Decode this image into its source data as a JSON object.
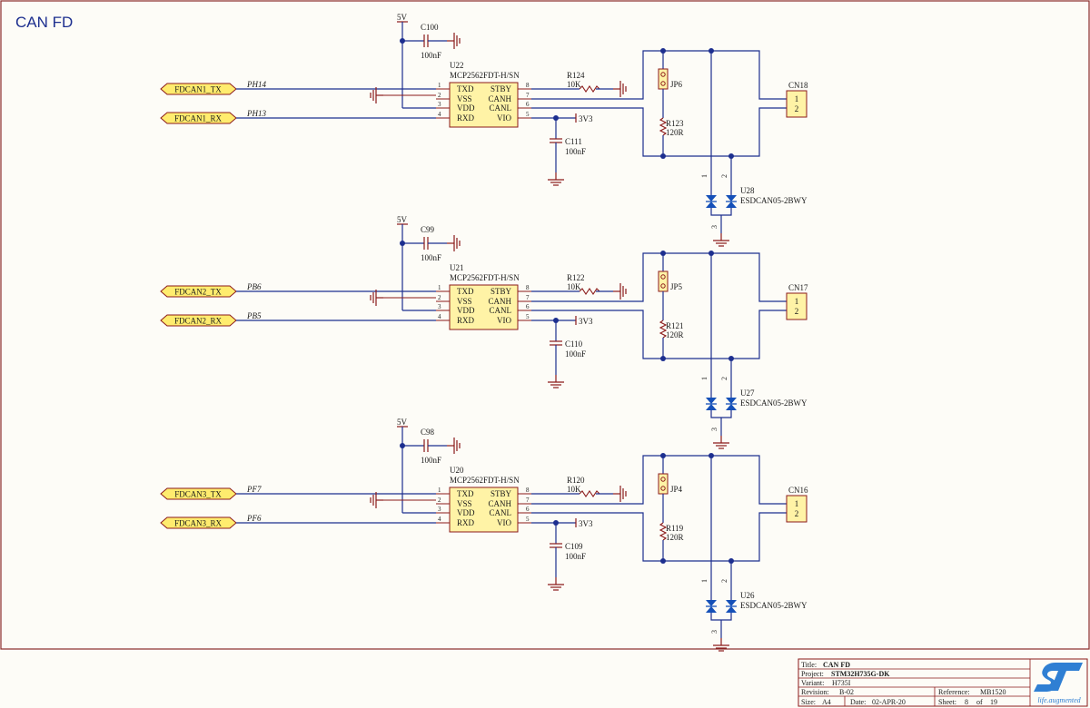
{
  "title": "CAN FD",
  "supply": {
    "v5": "5V",
    "v3": "3V3"
  },
  "pins": {
    "left": [
      {
        "num": "1",
        "name": "TXD"
      },
      {
        "num": "2",
        "name": "VSS"
      },
      {
        "num": "3",
        "name": "VDD"
      },
      {
        "num": "4",
        "name": "RXD"
      }
    ],
    "right": [
      {
        "num": "8",
        "name": "STBY"
      },
      {
        "num": "7",
        "name": "CANH"
      },
      {
        "num": "6",
        "name": "CANL"
      },
      {
        "num": "5",
        "name": "VIO"
      }
    ]
  },
  "channels": [
    {
      "tx_port": "FDCAN1_TX",
      "rx_port": "FDCAN1_RX",
      "tx_net": "PH14",
      "rx_net": "PH13",
      "cap_top": "C100",
      "cap_top_val": "100nF",
      "cap_bot": "C111",
      "cap_bot_val": "100nF",
      "ic_ref": "U22",
      "ic_part": "MCP2562FDT-H/SN",
      "res_pull": "R124",
      "res_pull_val": "10K",
      "res_term": "R123",
      "res_term_val": "120R",
      "jumper": "JP6",
      "connector": "CN18",
      "conn_pin1": "1",
      "conn_pin2": "2",
      "esd_ref": "U28",
      "esd_part": "ESDCAN05-2BWY",
      "esd_pin1": "1",
      "esd_pin2": "2",
      "esd_pin3": "3"
    },
    {
      "tx_port": "FDCAN2_TX",
      "rx_port": "FDCAN2_RX",
      "tx_net": "PB6",
      "rx_net": "PB5",
      "cap_top": "C99",
      "cap_top_val": "100nF",
      "cap_bot": "C110",
      "cap_bot_val": "100nF",
      "ic_ref": "U21",
      "ic_part": "MCP2562FDT-H/SN",
      "res_pull": "R122",
      "res_pull_val": "10K",
      "res_term": "R121",
      "res_term_val": "120R",
      "jumper": "JP5",
      "connector": "CN17",
      "conn_pin1": "1",
      "conn_pin2": "2",
      "esd_ref": "U27",
      "esd_part": "ESDCAN05-2BWY",
      "esd_pin1": "1",
      "esd_pin2": "2",
      "esd_pin3": "3"
    },
    {
      "tx_port": "FDCAN3_TX",
      "rx_port": "FDCAN3_RX",
      "tx_net": "PF7",
      "rx_net": "PF6",
      "cap_top": "C98",
      "cap_top_val": "100nF",
      "cap_bot": "C109",
      "cap_bot_val": "100nF",
      "ic_ref": "U20",
      "ic_part": "MCP2562FDT-H/SN",
      "res_pull": "R120",
      "res_pull_val": "10K",
      "res_term": "R119",
      "res_term_val": "120R",
      "jumper": "JP4",
      "connector": "CN16",
      "conn_pin1": "1",
      "conn_pin2": "2",
      "esd_ref": "U26",
      "esd_part": "ESDCAN05-2BWY",
      "esd_pin1": "1",
      "esd_pin2": "2",
      "esd_pin3": "3"
    }
  ],
  "title_block": {
    "title_label": "Title:",
    "title": "CAN FD",
    "project_label": "Project:",
    "project": "STM32H735G-DK",
    "variant_label": "Variant:",
    "variant": "H735I",
    "revision_label": "Revision:",
    "revision": "B-02",
    "reference_label": "Reference:",
    "reference": "MB1520",
    "size_label": "Size:",
    "size": "A4",
    "date_label": "Date:",
    "date": "02-APR-20",
    "sheet_label": "Sheet:",
    "sheet": "8",
    "of_label": "of",
    "sheet_total": "19"
  },
  "logo": {
    "mark": "ST",
    "tagline": "life.augmented"
  },
  "colors": {
    "wire": "#1d2f8f",
    "component": "#8b1a1a",
    "ic_fill": "#fff3a6",
    "port_fill": "#ffec6e",
    "junction": "#1d2f8f",
    "diode": "#1550b8",
    "text": "#1a1a1a",
    "border": "#8b2a2a",
    "logo": "#2f7fd3"
  }
}
